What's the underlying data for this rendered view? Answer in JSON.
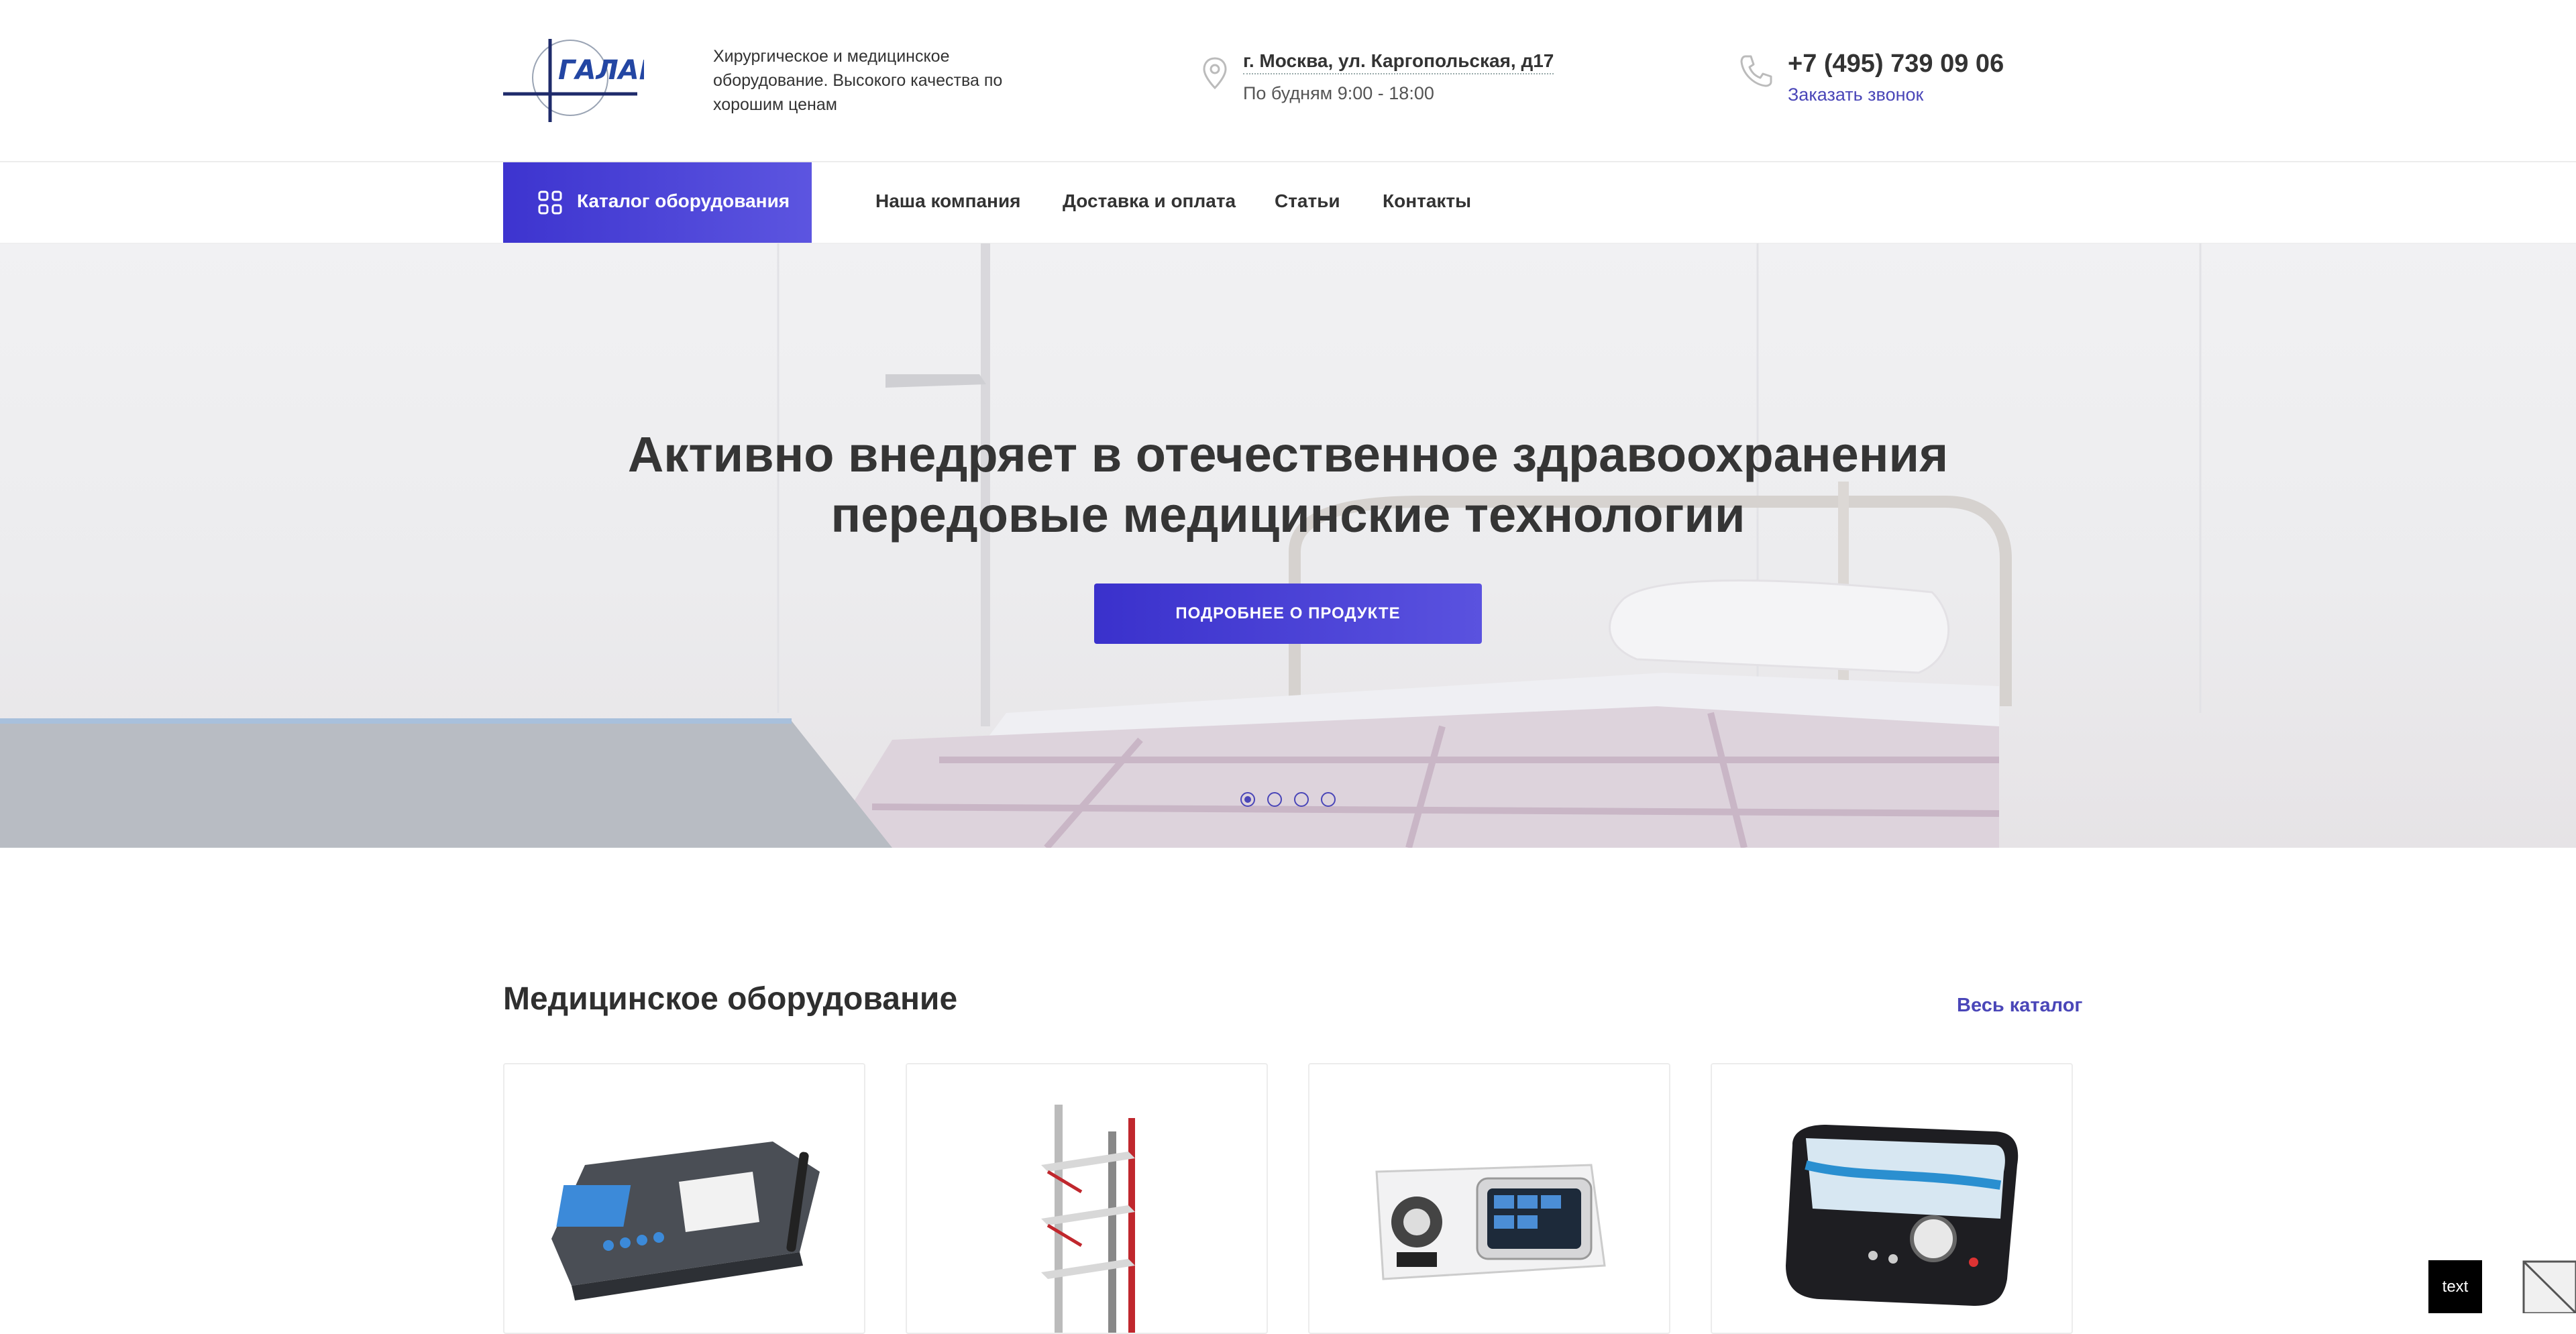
{
  "header": {
    "logo_text": "ГАЛАР",
    "tagline": "Хирургическое и медицинское оборудование. Высокого качества по хорошим ценам",
    "address": "г. Москва, ул. Каргопольская, д17",
    "hours": "По будням 9:00 - 18:00",
    "phone": "+7 (495) 739 09 06",
    "callback": "Заказать звонок"
  },
  "nav": {
    "catalog_label": "Каталог оборудования",
    "links": [
      "Наша компания",
      "Доставка и оплата",
      "Статьи",
      "Контакты"
    ]
  },
  "hero": {
    "title_line1": "Активно внедряет в отечественное здравоохранения",
    "title_line2": "передовые медицинские технологии",
    "button": "ПОДРОБНЕЕ О ПРОДУКТЕ",
    "slides_count": 4,
    "active_slide": 1
  },
  "section": {
    "title": "Медицинское оборудование",
    "all_link": "Весь каталог"
  },
  "products": [
    {
      "icon": "ecg-device-icon"
    },
    {
      "icon": "equipment-cart-icon"
    },
    {
      "icon": "endoscopy-processor-icon"
    },
    {
      "icon": "physiotherapy-device-icon"
    }
  ],
  "overlay": {
    "tag": "text"
  },
  "colors": {
    "accent": "#4a46b8",
    "button_gradient_start": "#3a31cc",
    "button_gradient_end": "#5a52df"
  }
}
